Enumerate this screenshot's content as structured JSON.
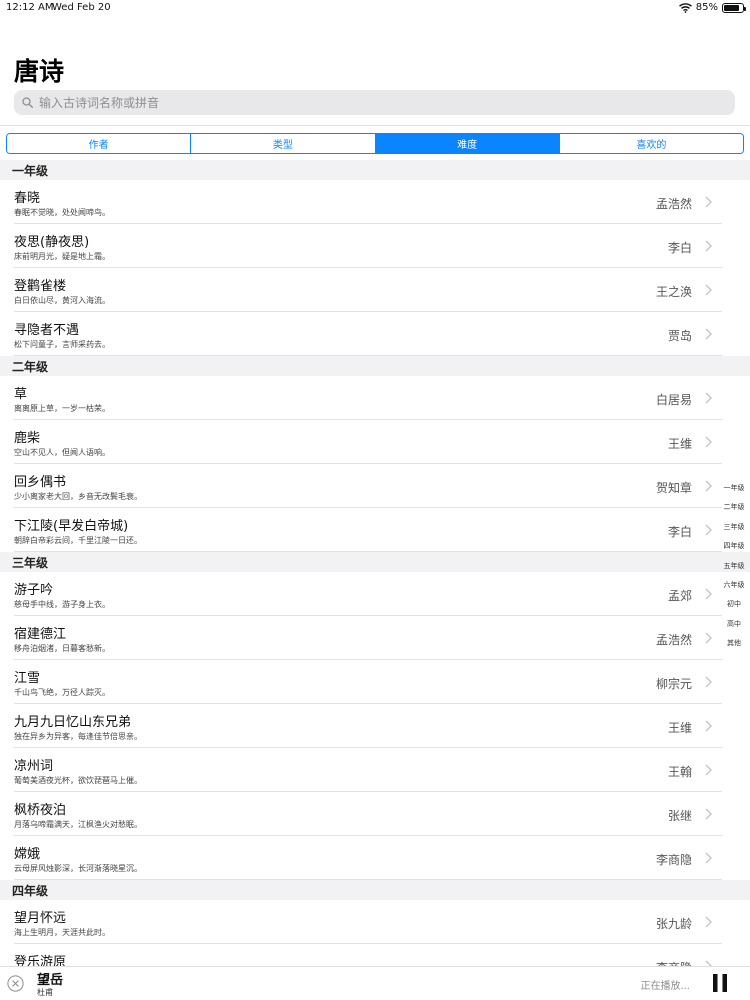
{
  "status_bar": {
    "time": "12:12 AM",
    "date": "Wed Feb 20",
    "battery": "85%",
    "battery_level": 0.85
  },
  "app": {
    "title": "唐诗"
  },
  "search": {
    "placeholder": "输入古诗词名称或拼音"
  },
  "segments": [
    {
      "label": "作者",
      "selected": false
    },
    {
      "label": "类型",
      "selected": false
    },
    {
      "label": "难度",
      "selected": true
    },
    {
      "label": "喜欢的",
      "selected": false
    }
  ],
  "sections": [
    {
      "header": "一年级",
      "rows": [
        {
          "title": "春晓",
          "subtitle": "春眠不觉晓，处处闻啼鸟。",
          "author": "孟浩然"
        },
        {
          "title": "夜思(静夜思)",
          "subtitle": "床前明月光，疑是地上霜。",
          "author": "李白"
        },
        {
          "title": "登鹳雀楼",
          "subtitle": "白日依山尽，黄河入海流。",
          "author": "王之涣"
        },
        {
          "title": "寻隐者不遇",
          "subtitle": "松下问童子，言师采药去。",
          "author": "贾岛"
        }
      ]
    },
    {
      "header": "二年级",
      "rows": [
        {
          "title": "草",
          "subtitle": "离离原上草，一岁一枯荣。",
          "author": "白居易"
        },
        {
          "title": "鹿柴",
          "subtitle": "空山不见人，但闻人语响。",
          "author": "王维"
        },
        {
          "title": "回乡偶书",
          "subtitle": "少小离家老大回，乡音无改鬓毛衰。",
          "author": "贺知章"
        },
        {
          "title": "下江陵(早发白帝城)",
          "subtitle": "朝辞白帝彩云间，千里江陵一日还。",
          "author": "李白"
        }
      ]
    },
    {
      "header": "三年级",
      "rows": [
        {
          "title": "游子吟",
          "subtitle": "慈母手中线，游子身上衣。",
          "author": "孟郊"
        },
        {
          "title": "宿建德江",
          "subtitle": "移舟泊烟渚，日暮客愁新。",
          "author": "孟浩然"
        },
        {
          "title": "江雪",
          "subtitle": "千山鸟飞绝，万径人踪灭。",
          "author": "柳宗元"
        },
        {
          "title": "九月九日忆山东兄弟",
          "subtitle": "独在异乡为异客，每逢佳节倍思亲。",
          "author": "王维"
        },
        {
          "title": "凉州词",
          "subtitle": "葡萄美酒夜光杯，欲饮琵琶马上催。",
          "author": "王翰"
        },
        {
          "title": "枫桥夜泊",
          "subtitle": "月落乌啼霜满天，江枫渔火对愁眠。",
          "author": "张继"
        },
        {
          "title": "嫦娥",
          "subtitle": "云母屏风烛影深，长河渐落晓星沉。",
          "author": "李商隐"
        }
      ]
    },
    {
      "header": "四年级",
      "rows": [
        {
          "title": "望月怀远",
          "subtitle": "海上生明月，天涯共此时。",
          "author": "张九龄"
        },
        {
          "title": "登乐游原",
          "subtitle": "",
          "author": "李商隐"
        }
      ]
    }
  ],
  "index_bar": [
    "一年级",
    "二年级",
    "三年级",
    "四年级",
    "五年级",
    "六年级",
    "初中",
    "高中",
    "其他"
  ],
  "player": {
    "title": "望岳",
    "author": "杜甫",
    "status": "正在播放..."
  },
  "colors": {
    "accent": "#0a84ff",
    "section_bg": "#f2f2f4",
    "search_bg": "#e8e8ea"
  }
}
